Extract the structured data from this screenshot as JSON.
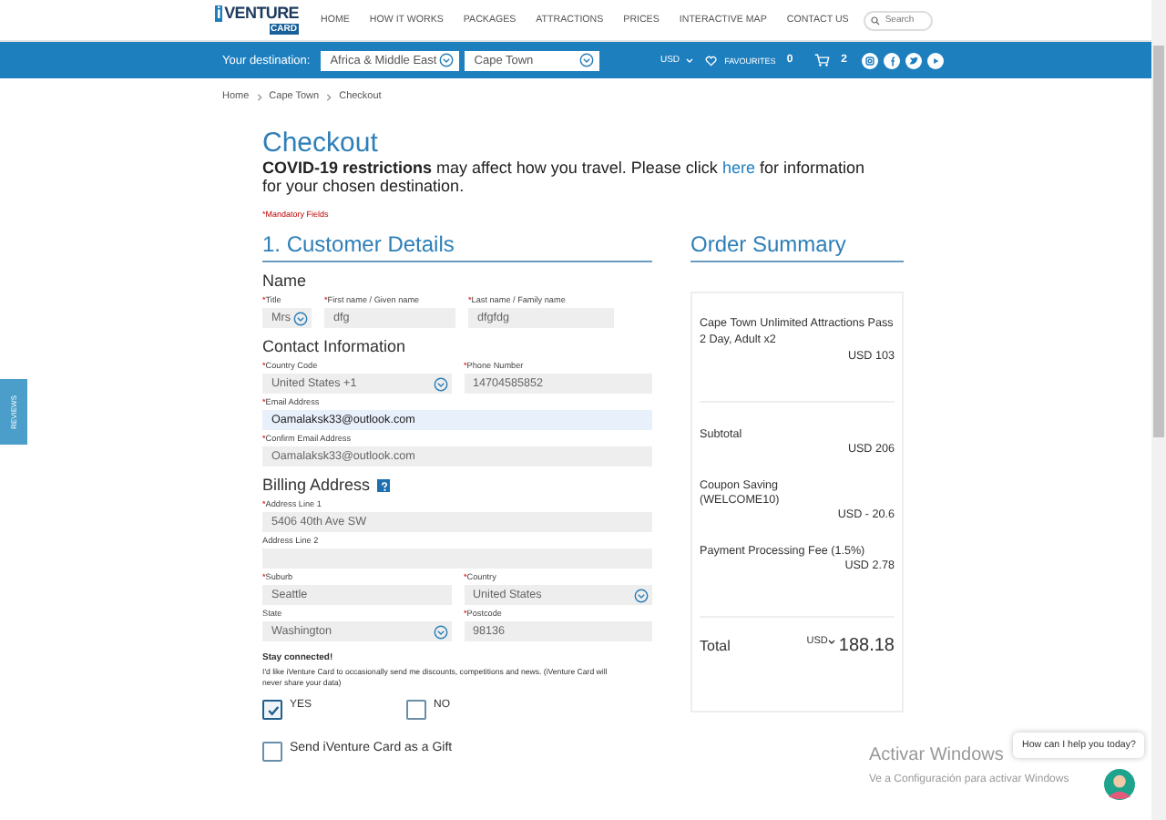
{
  "header": {
    "logo_mark": "i",
    "logo": "VENTURE",
    "logo_sub": "CARD",
    "nav": [
      "HOME",
      "HOW IT WORKS",
      "PACKAGES",
      "ATTRACTIONS",
      "PRICES",
      "INTERACTIVE MAP",
      "CONTACT US"
    ],
    "search": {
      "placeholder": "Search"
    }
  },
  "destination_bar": {
    "label": "Your destination:",
    "region": "Africa & Middle East",
    "city": "Cape Town",
    "currency": "USD",
    "favourites_label": "FAVOURITES",
    "favourites_count": "0",
    "cart_count": "2"
  },
  "breadcrumb": [
    "Home",
    "Cape Town",
    "Checkout"
  ],
  "title": "Checkout",
  "notice": {
    "before": "**COVID-19 restrictions** may affect how you travel. Please click",
    "link": "here",
    "after": "for information for your chosen destination."
  },
  "mandatory_note": "*Mandatory Fields",
  "section_title": "1. Customer Details",
  "groups": [
    {
      "heading": "Name",
      "help": false,
      "rows": [
        [
          {
            "mark": "*",
            "label": "Title",
            "value": "Mrs",
            "kind": "select",
            "focused": false
          },
          {
            "mark": "*",
            "label": "First name / Given name",
            "value": "dfg",
            "kind": "text",
            "focused": false
          },
          {
            "mark": "*",
            "label": "Last name / Family name",
            "value": "dfgfdg",
            "kind": "text",
            "focused": false
          }
        ]
      ]
    },
    {
      "heading": "Contact Information",
      "help": false,
      "rows": [
        [
          {
            "mark": "*",
            "label": "Country Code",
            "value": "United States +1",
            "kind": "select",
            "focused": false
          },
          {
            "mark": "*",
            "label": "Phone Number",
            "value": "14704585852",
            "kind": "text",
            "focused": false
          }
        ],
        [
          {
            "mark": "*",
            "label": "Email Address",
            "value": "Oamalaksk33@outlook.com",
            "kind": "text",
            "focused": true
          }
        ],
        [
          {
            "mark": "*",
            "label": "Confirm Email Address",
            "value": "Oamalaksk33@outlook.com",
            "kind": "text",
            "focused": false
          }
        ]
      ]
    },
    {
      "heading": "Billing Address",
      "help": true,
      "rows": [
        [
          {
            "mark": "*",
            "label": "Address Line 1",
            "value": "5406 40th Ave SW",
            "kind": "text",
            "focused": false
          }
        ],
        [
          {
            "label": "Address Line 2",
            "kind": "text",
            "focused": false
          }
        ],
        [
          {
            "mark": "*",
            "label": "Suburb",
            "value": "Seattle",
            "kind": "text",
            "focused": false
          },
          {
            "mark": "*",
            "label": "Country",
            "value": "United States",
            "kind": "select",
            "focused": false
          }
        ],
        [
          {
            "label": "State",
            "value": "Washington",
            "kind": "select",
            "focused": false
          },
          {
            "mark": "*",
            "label": "Postcode",
            "value": "98136",
            "kind": "text",
            "focused": false
          }
        ]
      ]
    }
  ],
  "newsletter": {
    "heading": "Stay connected!",
    "text": "I'd like iVenture Card to occasionally send me discounts, competitions and news. (iVenture Card will never share your data)",
    "options": [
      {
        "label": "YES",
        "checked": true
      },
      {
        "label": "NO",
        "checked": false
      }
    ]
  },
  "gift": {
    "label": "Send iVenture Card as a Gift",
    "checked": false
  },
  "summary": {
    "title": "Order Summary",
    "items": [
      {
        "name": "Cape Town Unlimited Attractions Pass 2 Day, Adult x2",
        "price": "USD 103"
      }
    ],
    "lines": [
      {
        "label": "Subtotal",
        "value": "USD 206"
      },
      {
        "label": "Coupon Saving",
        "code": "(WELCOME10)",
        "value": "USD - 20.6"
      },
      {
        "label": "Payment Processing Fee (1.5%)",
        "value": "USD 2.78"
      }
    ],
    "total": {
      "label": "Total",
      "currency": "USD",
      "amount": "188.18"
    }
  },
  "reviews_tab": "REVIEWS",
  "os_notice": {
    "title": "Activar Windows",
    "text": "Ve a Configuración para activar Windows"
  },
  "chat": {
    "prompt": "How can I help you today?"
  }
}
